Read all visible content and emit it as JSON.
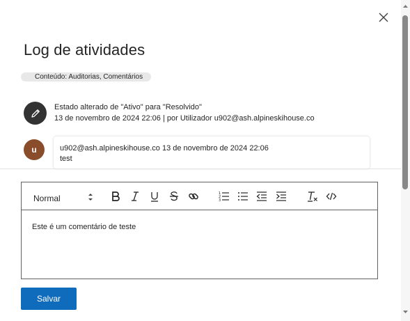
{
  "dialog": {
    "title": "Log de atividades",
    "filter_label": "Conteúdo: Auditorias, Comentários"
  },
  "activity": {
    "icon": "pencil-icon",
    "description": "Estado alterado de \"Ativo\" para \"Resolvido\"",
    "meta": "13 de novembro de 2024 22:06 | por Utilizador u902@ash.alpineskihouse.co"
  },
  "comment": {
    "avatar_initial": "u",
    "author": "u902@ash.alpineskihouse.co",
    "timestamp": "13 de novembro de 2024 22:06",
    "text": "test"
  },
  "editor": {
    "format_value": "Normal",
    "content": "Este é um comentário de teste",
    "toolbar": [
      "bold-icon",
      "italic-icon",
      "underline-icon",
      "strikethrough-icon",
      "link-icon",
      "numbered-list-icon",
      "bulleted-list-icon",
      "decrease-indent-icon",
      "increase-indent-icon",
      "clear-formatting-icon",
      "code-icon"
    ]
  },
  "actions": {
    "save_label": "Salvar"
  },
  "colors": {
    "primary": "#0f6cbd",
    "avatar_user": "#8a4d2b",
    "avatar_activity": "#333333"
  }
}
